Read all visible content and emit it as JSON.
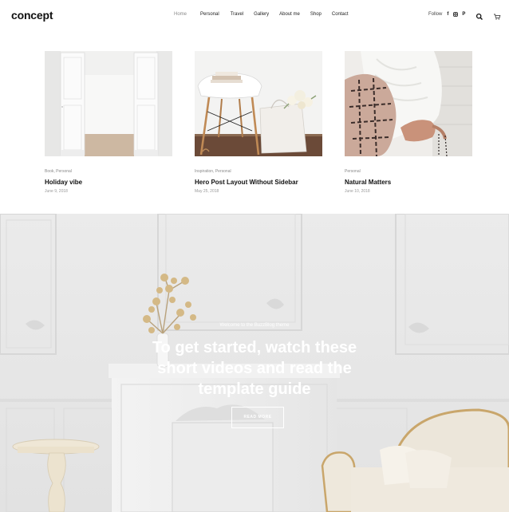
{
  "header": {
    "logo": "concept",
    "nav": [
      {
        "label": "Home",
        "active": true
      },
      {
        "label": "Personal",
        "active": false
      },
      {
        "label": "Travel",
        "active": false
      },
      {
        "label": "Gallery",
        "active": false
      },
      {
        "label": "About me",
        "active": false
      },
      {
        "label": "Shop",
        "active": false
      },
      {
        "label": "Contact",
        "active": false
      }
    ],
    "follow_label": "Follow",
    "social": [
      "facebook-icon",
      "instagram-icon",
      "pinterest-icon"
    ],
    "search_icon": "search-icon",
    "cart_icon": "cart-icon"
  },
  "posts": [
    {
      "category": "Book, Personal",
      "title": "Holiday vibe",
      "date": "June 9, 2018",
      "image": "white-doors-photo"
    },
    {
      "category": "Inspiration, Personal",
      "title": "Hero Post Layout Without Sidebar",
      "date": "May 25, 2018",
      "image": "chair-and-bag-photo"
    },
    {
      "category": "Personal",
      "title": "Natural Matters",
      "date": "June 10, 2018",
      "image": "knit-blanket-photo"
    }
  ],
  "hero": {
    "kicker": "Welcome to the BuzzBlog theme",
    "title_lines": [
      "To get started, watch these",
      "short videos and read the",
      "template guide"
    ],
    "button_label": "READ MORE",
    "image": "white-interior-photo"
  }
}
